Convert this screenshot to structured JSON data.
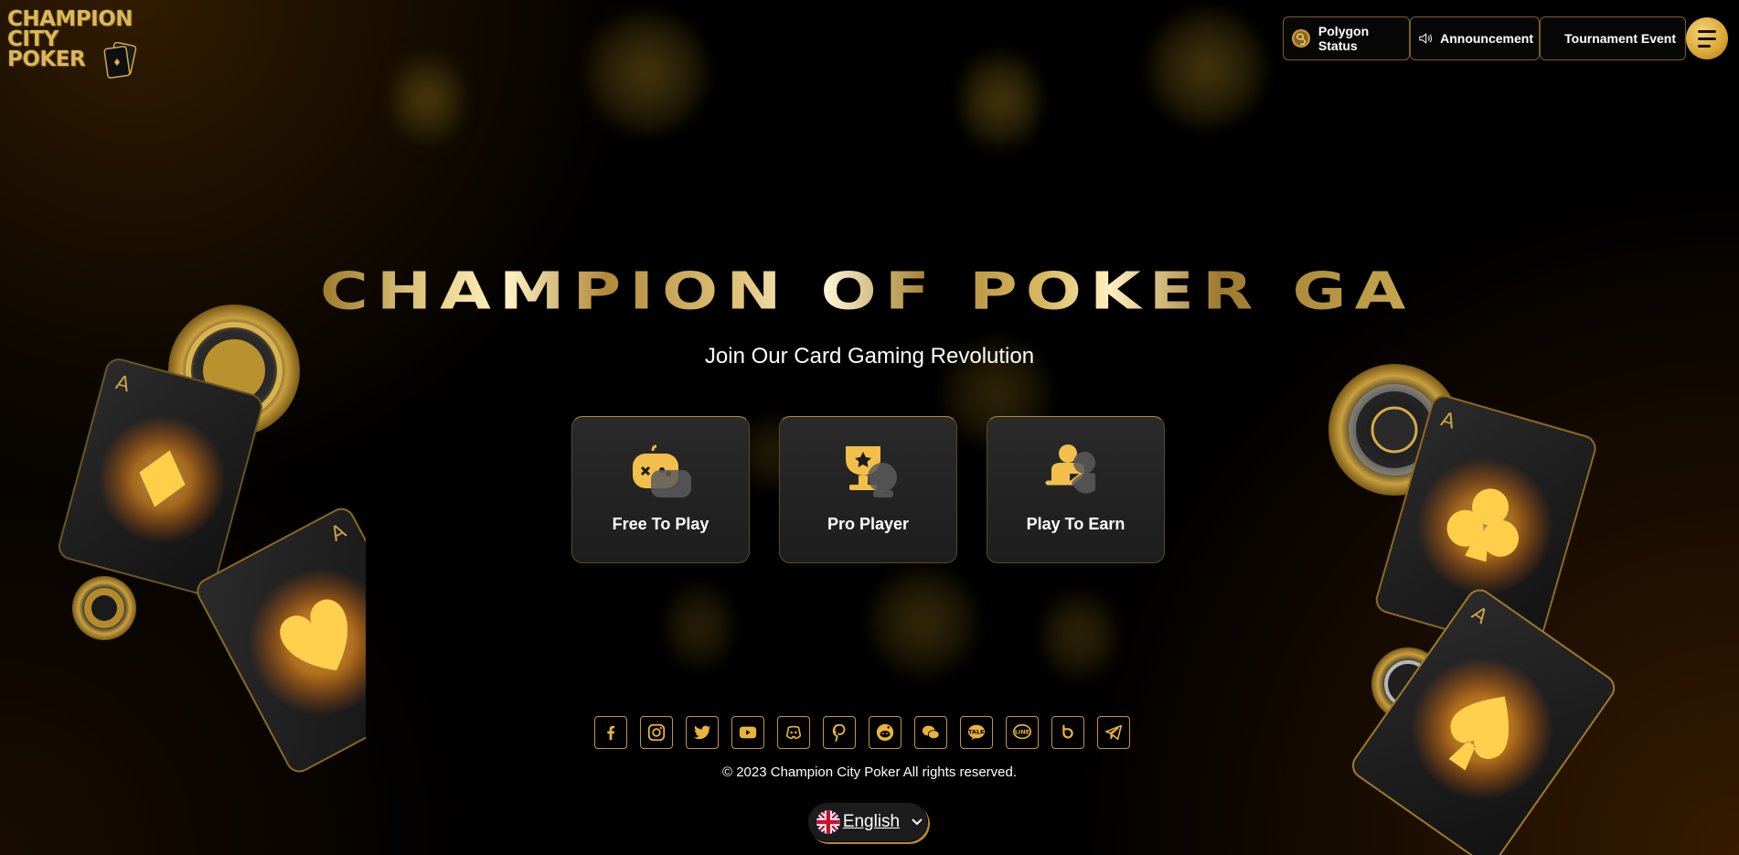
{
  "header": {
    "logo_text_line1": "CHAMPION",
    "logo_text_line2": "CITY",
    "logo_text_line3": "POKER",
    "buttons": [
      {
        "label": "Polygon Status",
        "icon": "polygon-coin-icon"
      },
      {
        "label": "Announcement",
        "icon": "speaker-icon"
      },
      {
        "label": "Tournament Event",
        "icon": ""
      }
    ],
    "menu_icon": "hamburger-menu-icon"
  },
  "hero": {
    "title": "CHAMPION OF POKER GAME",
    "subtitle": "Join Our Card Gaming Revolution"
  },
  "modes": [
    {
      "label": "Free To Play",
      "icon": "gamepad-icon"
    },
    {
      "label": "Pro Player",
      "icon": "trophy-icon"
    },
    {
      "label": "Play To Earn",
      "icon": "earn-user-icon"
    }
  ],
  "social": [
    "facebook-icon",
    "instagram-icon",
    "twitter-icon",
    "youtube-icon",
    "discord-icon",
    "pinterest-icon",
    "reddit-icon",
    "wechat-icon",
    "kakaotalk-icon",
    "line-icon",
    "tiktok-icon",
    "telegram-icon"
  ],
  "footer": {
    "copyright": "© 2023 Champion City Poker All rights reserved."
  },
  "language": {
    "selected": "English",
    "flag": "uk-flag-icon"
  },
  "decor_playing_cards": [
    "A",
    "A",
    "A",
    "A"
  ],
  "colors": {
    "accent_gold": "#d9a532",
    "border_gold": "#c6962a",
    "card_bg": "#242424",
    "background": "#000000"
  }
}
